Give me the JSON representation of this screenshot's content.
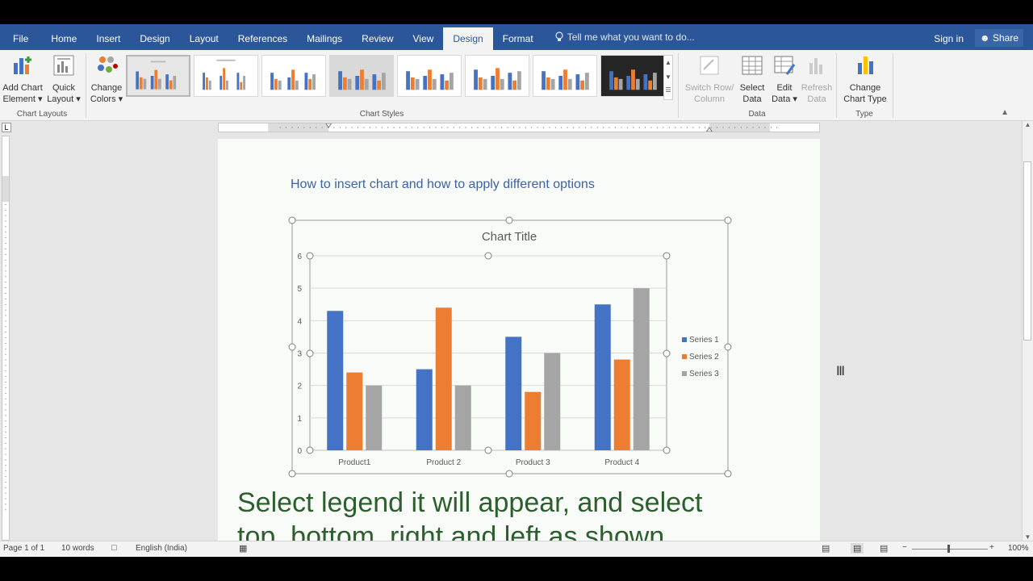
{
  "ribbon_tabs": [
    "File",
    "Home",
    "Insert",
    "Design",
    "Layout",
    "References",
    "Mailings",
    "Review",
    "View",
    "Design",
    "Format"
  ],
  "tell_me": "Tell me what you want to do...",
  "sign_in": "Sign in",
  "share": "Share",
  "ribbon": {
    "add_chart_element": [
      "Add Chart",
      "Element ▾"
    ],
    "quick_layout": [
      "Quick",
      "Layout ▾"
    ],
    "change_colors": [
      "Change",
      "Colors ▾"
    ],
    "group_chart_layouts": "Chart Layouts",
    "group_chart_styles": "Chart Styles",
    "switch_row_column": [
      "Switch Row/",
      "Column"
    ],
    "select_data": [
      "Select",
      "Data"
    ],
    "edit_data": [
      "Edit",
      "Data ▾"
    ],
    "refresh_data": [
      "Refresh",
      "Data"
    ],
    "group_data": "Data",
    "change_chart_type": [
      "Change",
      "Chart Type"
    ],
    "group_type": "Type"
  },
  "document": {
    "heading": "How to insert chart and how to apply different options",
    "caption_line1": "Select legend it will appear, and select",
    "caption_line2": " top, bottom, right and left as shown"
  },
  "chart_data": {
    "type": "bar",
    "title": "Chart Title",
    "categories": [
      "Product1",
      "Product 2",
      "Product 3",
      "Product 4"
    ],
    "series": [
      {
        "name": "Series 1",
        "values": [
          4.3,
          2.5,
          3.5,
          4.5
        ],
        "color": "#4472c4"
      },
      {
        "name": "Series 2",
        "values": [
          2.4,
          4.4,
          1.8,
          2.8
        ],
        "color": "#ed7d31"
      },
      {
        "name": "Series 3",
        "values": [
          2,
          2,
          3,
          5
        ],
        "color": "#a5a5a5"
      }
    ],
    "ylim": [
      0,
      6
    ],
    "yticks": [
      0,
      1,
      2,
      3,
      4,
      5,
      6
    ],
    "legend": "right",
    "grid": true
  },
  "status": {
    "page": "Page 1 of 1",
    "words": "10 words",
    "language": "English (India)",
    "zoom": "100%"
  }
}
